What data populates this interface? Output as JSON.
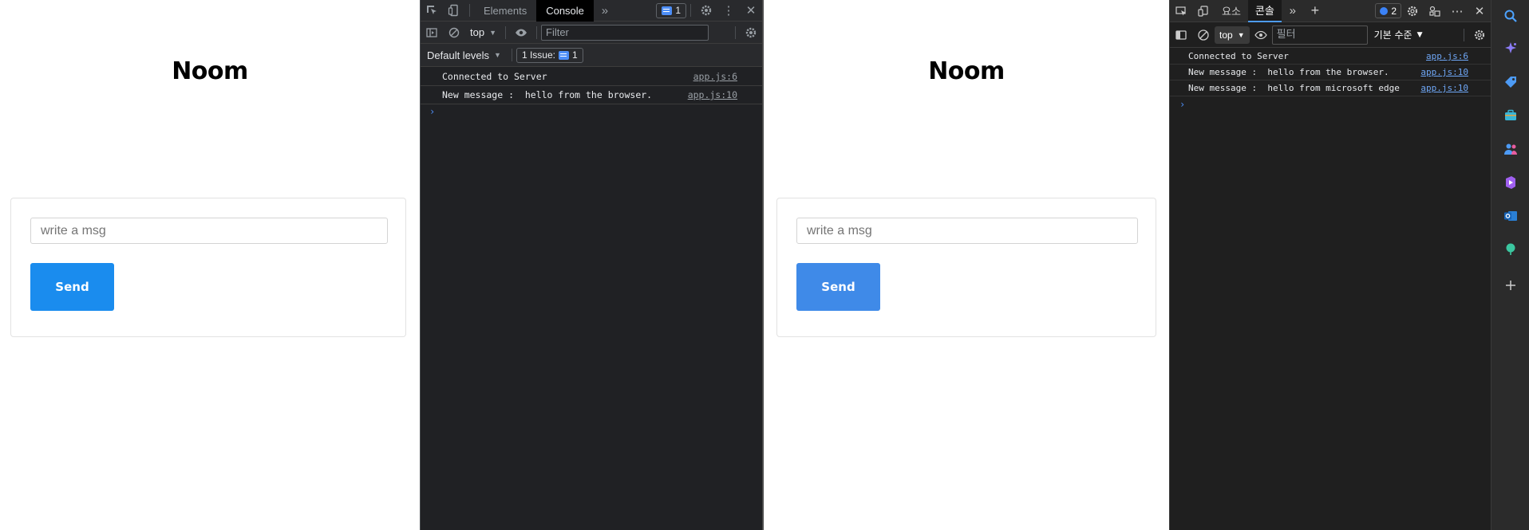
{
  "left_page": {
    "title": "Noom",
    "input_placeholder": "write a msg",
    "send_label": "Send"
  },
  "chrome_devtools": {
    "tabs": [
      "Elements",
      "Console"
    ],
    "active_tab": "Console",
    "issue_count": "1",
    "context": "top",
    "filter_placeholder": "Filter",
    "levels_label": "Default levels",
    "issues_label": "1 Issue:",
    "issues_count": "1",
    "logs": [
      {
        "message": "Connected to Server",
        "source": "app.js:6"
      },
      {
        "message": "New message :  hello from the browser.",
        "source": "app.js:10"
      }
    ],
    "prompt": "›"
  },
  "right_page": {
    "title": "Noom",
    "input_placeholder": "write a msg",
    "send_label": "Send"
  },
  "edge_devtools": {
    "tabs": [
      "요소",
      "콘솔"
    ],
    "active_tab": "콘솔",
    "issue_count": "2",
    "context": "top",
    "filter_placeholder": "필터",
    "levels_label": "기본 수준",
    "logs": [
      {
        "message": "Connected to Server",
        "source": "app.js:6"
      },
      {
        "message": "New message :  hello from the browser.",
        "source": "app.js:10"
      },
      {
        "message": "New message :  hello from microsoft edge",
        "source": "app.js:10"
      }
    ],
    "prompt": "›"
  },
  "colors": {
    "chrome_send": "#1a8cee",
    "edge_send": "#3f8ae8",
    "devtools_bg": "#202124",
    "link_blue": "#6ea6f5"
  }
}
